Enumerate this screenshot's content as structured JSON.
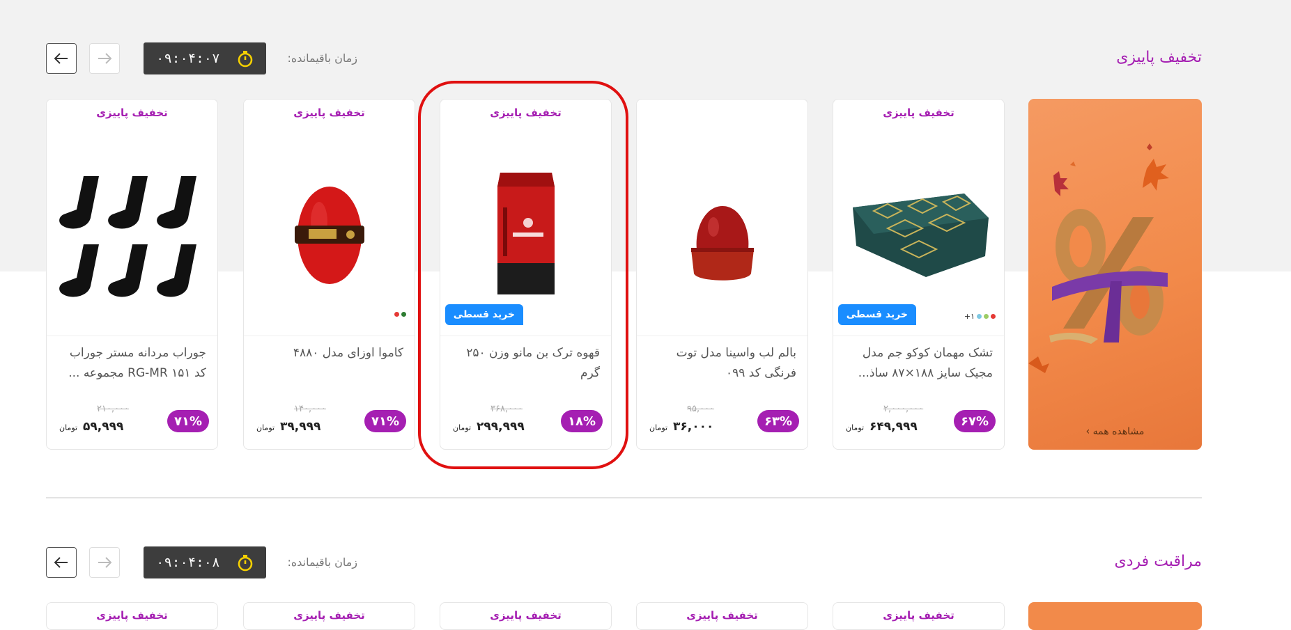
{
  "section1": {
    "title": "تخفیف پاییزی",
    "timer_label": "زمان باقیمانده:",
    "timer_value": "۰۹:۰۴:۰۷"
  },
  "banner": {
    "see_all": "مشاهده همه ›"
  },
  "products": [
    {
      "badge": "تخفیف پاییزی",
      "name": "تشک مهمان کوکو جم مدل مجیک سایز ۱۸۸×۸۷ ساذ...",
      "installment": "خرید قسطی",
      "colors_more": "+۱",
      "old_price": "۲,۰۰۰,۰۰۰",
      "new_price": "۶۴۹,۹۹۹",
      "currency": "تومان",
      "discount": "۶۷%"
    },
    {
      "badge": "",
      "name": "بالم لب واسینا مدل توت فرنگی کد ۰۹۹",
      "old_price": "۹۵,۰۰۰",
      "new_price": "۳۶,۰۰۰",
      "currency": "تومان",
      "discount": "۶۳%"
    },
    {
      "badge": "تخفیف پاییزی",
      "name": "قهوه ترک بن مانو وزن ۲۵۰ گرم",
      "installment": "خرید قسطی",
      "old_price": "۳۶۸,۰۰۰",
      "new_price": "۲۹۹,۹۹۹",
      "currency": "تومان",
      "discount": "۱۸%"
    },
    {
      "badge": "تخفیف پاییزی",
      "name": "کاموا اوزای مدل ۴۸۸۰",
      "old_price": "۱۴۰,۰۰۰",
      "new_price": "۳۹,۹۹۹",
      "currency": "تومان",
      "discount": "۷۱%"
    },
    {
      "badge": "تخفیف پاییزی",
      "name": "جوراب مردانه مستر جوراب کد RG-MR ۱۵۱ مجموعه ...",
      "old_price": "۲۱۰,۰۰۰",
      "new_price": "۵۹,۹۹۹",
      "currency": "تومان",
      "discount": "۷۱%"
    }
  ],
  "section2": {
    "title": "مراقبت فردی",
    "timer_label": "زمان باقیمانده:",
    "timer_value": "۰۹:۰۴:۰۸",
    "card_badge": "تخفیف پاییزی"
  },
  "colors": {
    "accent_purple": "#a51fb2",
    "installment_blue": "#1a8dff",
    "timer_bg": "#3d3d3d",
    "timer_icon": "#f5d000",
    "highlight_red": "#e01010"
  }
}
